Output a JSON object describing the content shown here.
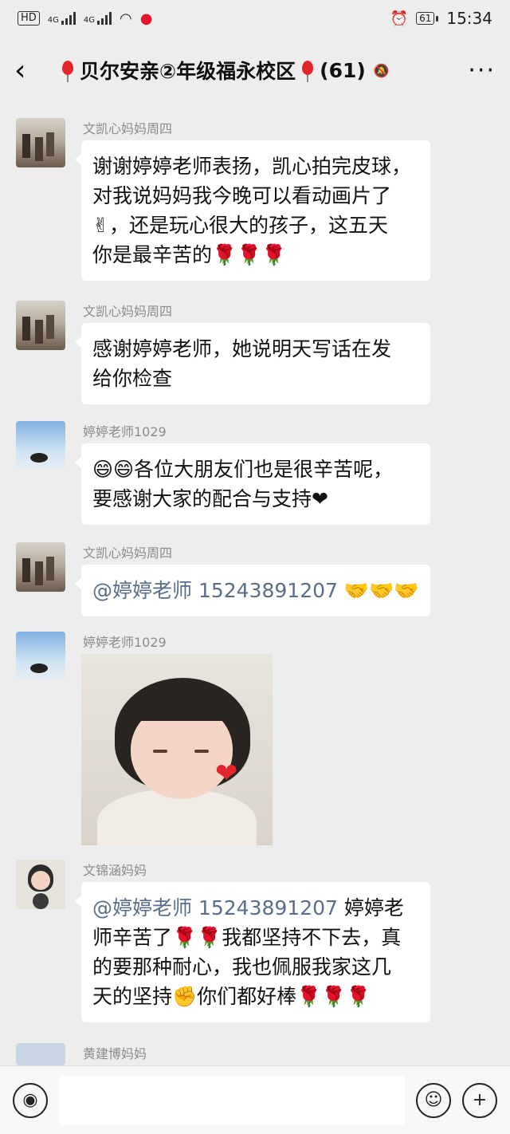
{
  "status_bar": {
    "hd_label": "HD",
    "net1": "4G",
    "net2": "4G",
    "battery": "61",
    "time": "15:34"
  },
  "header": {
    "back_icon": "chevron-left-icon",
    "title": "贝尔安亲②年级福永校区",
    "member_count": "(61)",
    "more_label": "···"
  },
  "messages": [
    {
      "sender": "文凯心妈妈周四",
      "avatar": "street-photo",
      "lines": [
        "谢谢婷婷老师表扬，凯心拍完皮球，",
        "对我说妈妈我今晚可以看动画片了",
        "✌，还是玩心很大的孩子，这五天",
        "你是最辛苦的🌹🌹🌹"
      ]
    },
    {
      "sender": "文凯心妈妈周四",
      "avatar": "street-photo",
      "lines": [
        "感谢婷婷老师，她说明天写话在发",
        "给你检查"
      ]
    },
    {
      "sender": "婷婷老师1029",
      "avatar": "sky-photo",
      "lines": [
        "😄😄各位大朋友们也是很辛苦呢，",
        "要感谢大家的配合与支持❤"
      ]
    },
    {
      "sender": "文凯心妈妈周四",
      "avatar": "street-photo",
      "mention": "@婷婷老师",
      "phone": "15243891207",
      "tail": "🤝🤝🤝"
    },
    {
      "sender": "婷婷老师1029",
      "avatar": "sky-photo",
      "image": "toddler-with-heart-photo"
    },
    {
      "sender": "文锦涵妈妈",
      "avatar": "girl-avatar",
      "mention": "@婷婷老师",
      "phone": "15243891207",
      "first_tail": "婷婷老",
      "lines": [
        "师辛苦了🌹🌹我都坚持不下去，真",
        "的要那种耐心，我也佩服我家这几",
        "天的坚持✊你们都好棒🌹🌹🌹"
      ]
    },
    {
      "sender": "黄建博妈妈",
      "avatar": "partial-avatar"
    }
  ],
  "bottom_bar": {
    "voice_icon": "voice-icon",
    "emoji_icon": "emoji-icon",
    "plus_icon": "plus-icon"
  }
}
